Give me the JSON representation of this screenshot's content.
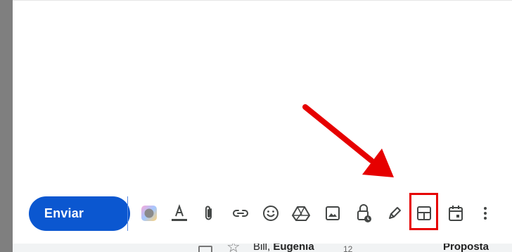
{
  "compose": {
    "send_label": "Enviar",
    "send_options_icon": "arrow-drop-down-icon"
  },
  "toolbar": {
    "items": [
      {
        "name": "signature-color-icon",
        "label": "Signature"
      },
      {
        "name": "text-format-icon",
        "label": "Formatting options"
      },
      {
        "name": "attach-icon",
        "label": "Attach files"
      },
      {
        "name": "link-icon",
        "label": "Insert link"
      },
      {
        "name": "emoji-icon",
        "label": "Insert emoji"
      },
      {
        "name": "drive-icon",
        "label": "Insert files using Drive"
      },
      {
        "name": "photo-icon",
        "label": "Insert photo"
      },
      {
        "name": "confidential-mode-icon",
        "label": "Confidential mode"
      },
      {
        "name": "pen-signature-icon",
        "label": "Insert signature"
      },
      {
        "name": "layout-icon",
        "label": "Layouts"
      },
      {
        "name": "schedule-event-icon",
        "label": "Set up a time to meet"
      },
      {
        "name": "more-options-icon",
        "label": "More options"
      }
    ],
    "highlighted": "layout-icon"
  },
  "background_list": {
    "row": {
      "sender_prefix": "Bill,",
      "sender_bold": "Eugenia",
      "count": "12",
      "subject": "Proposta"
    }
  },
  "colors": {
    "send_blue": "#0b57d0",
    "highlight_red": "#e60000",
    "icon_gray": "#444746"
  }
}
